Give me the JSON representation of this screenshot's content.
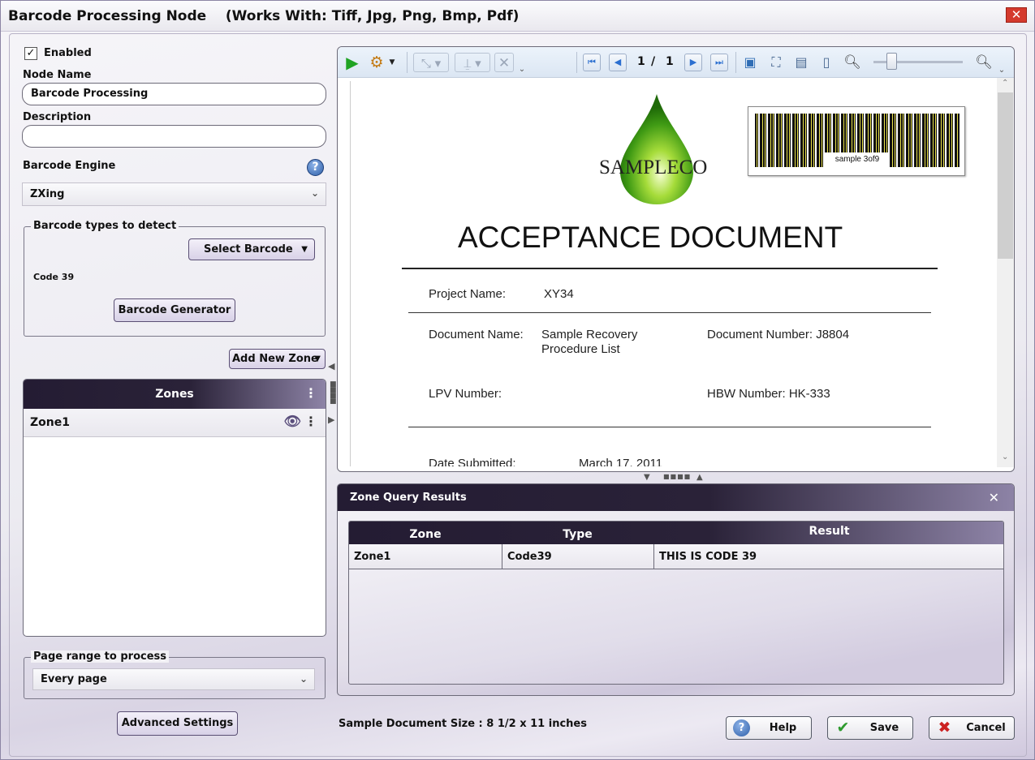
{
  "window": {
    "title": "Barcode Processing Node    (Works With: Tiff, Jpg, Png, Bmp, Pdf)",
    "close_glyph": "✕"
  },
  "left": {
    "enabled_label": "Enabled",
    "enabled_checked": true,
    "node_name_label": "Node Name",
    "node_name_value": "Barcode Processing",
    "description_label": "Description",
    "description_value": "",
    "engine_label": "Barcode Engine",
    "engine_value": "ZXing",
    "types_legend": "Barcode types to detect",
    "select_barcode_label": "Select Barcode",
    "detected_type": "Code 39",
    "generator_label": "Barcode Generator",
    "add_zone_label": "Add New Zone",
    "zones_header": "Zones",
    "zones": [
      {
        "name": "Zone1"
      }
    ],
    "page_range_legend": "Page range to process",
    "page_range_value": "Every page",
    "advanced_label": "Advanced Settings"
  },
  "viewer": {
    "page_current": "1",
    "page_sep": "/",
    "page_total": "1",
    "zoom_fraction": 0.2,
    "document": {
      "company": "SAMPLECO",
      "barcode_caption": "sample 3of9",
      "title": "ACCEPTANCE DOCUMENT",
      "project_label": "Project Name:",
      "project_value": "XY34",
      "doc_name_label": "Document Name:",
      "doc_name_value_1": "Sample Recovery",
      "doc_name_value_2": "Procedure List",
      "doc_number": "Document Number: J8804",
      "lpv_label": "LPV Number:",
      "hbw": "HBW Number: HK-333",
      "date_label": "Date Submitted:",
      "date_value": "March 17, 2011"
    }
  },
  "results": {
    "title": "Zone Query Results",
    "columns": [
      "Zone",
      "Type",
      "Result"
    ],
    "rows": [
      {
        "zone": "Zone1",
        "type": "Code39",
        "result": "THIS IS CODE 39"
      }
    ]
  },
  "footer": {
    "doc_size": "Sample Document Size : 8 1/2 x 11 inches",
    "help_label": "Help",
    "save_label": "Save",
    "cancel_label": "Cancel"
  },
  "colors": {
    "header_dark": "#241c33",
    "header_light": "#8d83a6",
    "play_green": "#1fa323",
    "save_check": "#2e9a2e",
    "cancel_x": "#cc2222"
  }
}
